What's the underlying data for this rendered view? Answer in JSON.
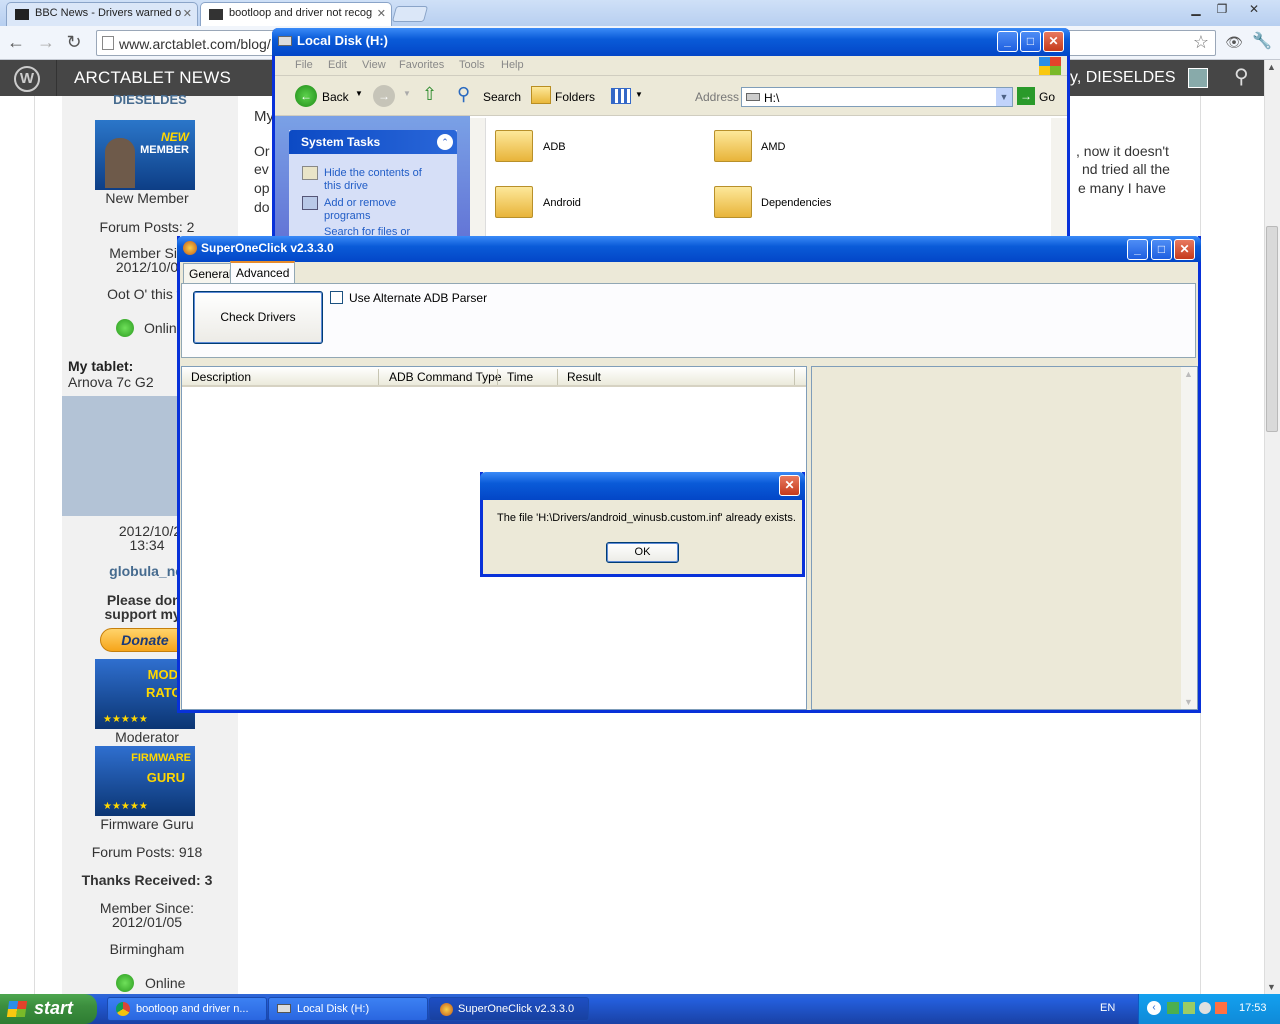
{
  "browser": {
    "tabs": [
      {
        "label": "BBC News - Drivers warned o"
      },
      {
        "label": "bootloop and driver not recog"
      }
    ],
    "url": "www.arctablet.com/blog/"
  },
  "site": {
    "title": "ARCTABLET NEWS",
    "greeting": "y, DIESELDES"
  },
  "page": {
    "post_snippets": [
      "My",
      "Or",
      "ev",
      "op",
      "do"
    ],
    "post_right": [
      ", now it doesn't",
      "nd tried all the",
      "e many I have"
    ],
    "user1": {
      "name": "DIESELDES",
      "rank": "New Member",
      "forum_posts": "Forum Posts: 2",
      "member_since_label": "Member Sin",
      "member_since_date": "2012/10/0",
      "location": "Oot O' this w",
      "status": "Online",
      "tablet_label": "My tablet:",
      "tablet_value": "Arnova 7c G2"
    },
    "post2": {
      "date": "2012/10/2",
      "time": "13:34",
      "author": "globula_nea",
      "donate_text_1": "Please donat",
      "donate_text_2": "support my w",
      "donate_btn": "Donate",
      "badge1_rank": "Moderator",
      "badge2_rank": "Firmware Guru",
      "forum_posts": "Forum Posts: 918",
      "thanks": "Thanks Received: 3",
      "member_since_label": "Member Since:",
      "member_since_date": "2012/01/05",
      "location": "Birmingham",
      "status": "Online"
    },
    "badges": {
      "new_member_1": "NEW",
      "new_member_2": "MEMBER",
      "moderator_1": "MODE-",
      "moderator_2": "RATOR",
      "firmware_1": "FIRMWARE",
      "firmware_2": "GURU"
    }
  },
  "explorer": {
    "title": "Local Disk (H:)",
    "menu": [
      "File",
      "Edit",
      "View",
      "Favorites",
      "Tools",
      "Help"
    ],
    "back": "Back",
    "search": "Search",
    "folders": "Folders",
    "address_label": "Address",
    "address_value": "H:\\",
    "go": "Go",
    "system_tasks": "System Tasks",
    "tasks": [
      "Hide the contents of this drive",
      "Add or remove programs",
      "Search for files or"
    ],
    "files": [
      "ADB",
      "AMD",
      "Android",
      "Dependencies"
    ]
  },
  "soc": {
    "title": "SuperOneClick v2.3.3.0",
    "tabs": [
      "General",
      "Advanced"
    ],
    "check_drivers": "Check Drivers",
    "alt_parser": "Use Alternate ADB Parser",
    "columns": [
      "Description",
      "ADB Command Type",
      "Time",
      "Result"
    ]
  },
  "dialog": {
    "message": "The file 'H:\\Drivers/android_winusb.custom.inf' already exists.",
    "ok": "OK"
  },
  "taskbar": {
    "start": "start",
    "items": [
      "bootloop and driver n...",
      "Local Disk (H:)",
      "SuperOneClick v2.3.3.0"
    ],
    "lang": "EN",
    "clock": "17:53"
  }
}
